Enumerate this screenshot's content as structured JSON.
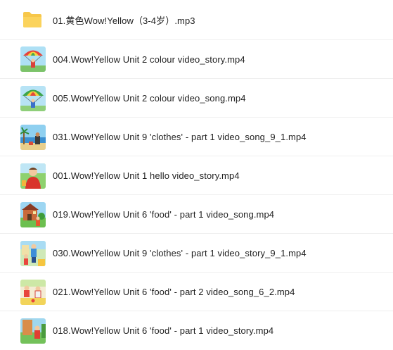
{
  "files": [
    {
      "name": "01.黄色Wow!Yellow（3-4岁）.mp3",
      "icon": "folder-icon",
      "type": "folder",
      "color": "#f7c74a"
    },
    {
      "name": "004.Wow!Yellow Unit 2 colour video_story.mp4",
      "icon": "video-thumbnail-parachute",
      "type": "video"
    },
    {
      "name": "005.Wow!Yellow Unit 2 colour video_song.mp4",
      "icon": "video-thumbnail-parachute",
      "type": "video"
    },
    {
      "name": "031.Wow!Yellow Unit 9 'clothes' - part 1 video_song_9_1.mp4",
      "icon": "video-thumbnail-beach",
      "type": "video"
    },
    {
      "name": "001.Wow!Yellow Unit 1 hello video_story.mp4",
      "icon": "video-thumbnail-presenter",
      "type": "video"
    },
    {
      "name": "019.Wow!Yellow Unit 6 'food' - part 1 video_song.mp4",
      "icon": "video-thumbnail-house",
      "type": "video"
    },
    {
      "name": "030.Wow!Yellow Unit 9 'clothes' - part 1 video_story_9_1.mp4",
      "icon": "video-thumbnail-kids",
      "type": "video"
    },
    {
      "name": "021.Wow!Yellow Unit 6 'food' - part 2 video_song_6_2.mp4",
      "icon": "video-thumbnail-kids",
      "type": "video"
    },
    {
      "name": "018.Wow!Yellow Unit 6 'food' - part 1 video_story.mp4",
      "icon": "video-thumbnail-house",
      "type": "video"
    }
  ]
}
